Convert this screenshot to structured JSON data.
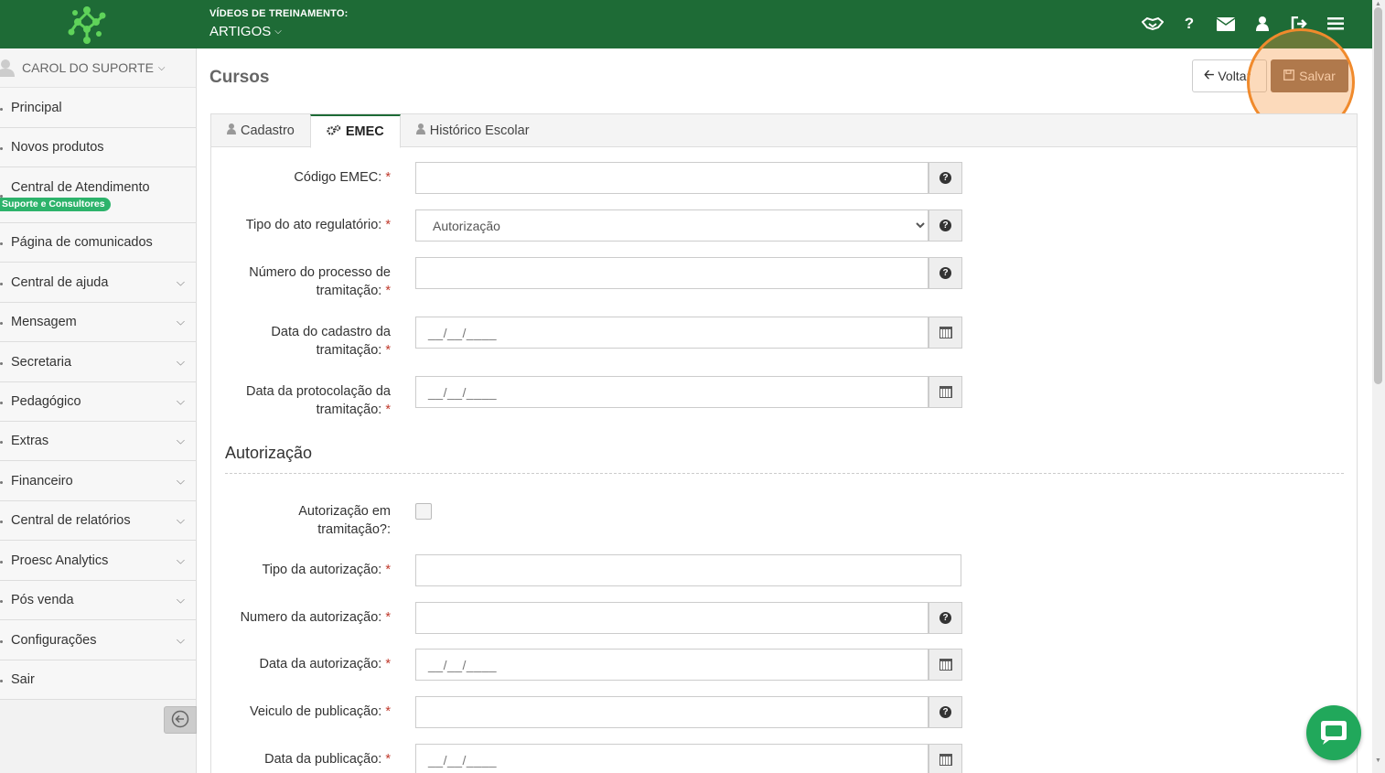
{
  "topbar": {
    "label": "VÍDEOS DE TREINAMENTO:",
    "menu": "ARTIGOS",
    "icons": [
      "handshake-icon",
      "question-icon",
      "envelope-icon",
      "user-icon",
      "sign-out-icon",
      "menu-icon"
    ]
  },
  "sidebar": {
    "user": "CAROL DO SUPORTE",
    "items": [
      {
        "label": "Principal"
      },
      {
        "label": "Novos produtos"
      },
      {
        "label": "Central de Atendimento",
        "badge": "Suporte e Consultores"
      },
      {
        "label": "Página de comunicados"
      },
      {
        "label": "Central de ajuda"
      },
      {
        "label": "Mensagem"
      },
      {
        "label": "Secretaria"
      },
      {
        "label": "Pedagógico"
      },
      {
        "label": "Extras"
      },
      {
        "label": "Financeiro"
      },
      {
        "label": "Central de relatórios"
      },
      {
        "label": "Proesc Analytics"
      },
      {
        "label": "Pós venda"
      },
      {
        "label": "Configurações"
      },
      {
        "label": "Sair"
      }
    ]
  },
  "main": {
    "title": "Cursos",
    "back_label": "Voltar",
    "save_label": "Salvar",
    "tabs": [
      {
        "label": "Cadastro"
      },
      {
        "label": "EMEC"
      },
      {
        "label": "Histórico Escolar"
      }
    ],
    "section_title": "Autorização",
    "date_placeholder": "__/__/____",
    "fields": {
      "codigo_emec": "Código EMEC:",
      "tipo_ato_l1": "Tipo do ato regulatório:",
      "tipo_ato_value": "Autorização",
      "numero_processo_l1": "Número do processo de",
      "numero_processo_l2": "tramitação:",
      "data_cadastro_l1": "Data do cadastro da",
      "data_cadastro_l2": "tramitação:",
      "data_protocolacao_l1": "Data da protocolação da",
      "data_protocolacao_l2": "tramitação:",
      "aut_tramitacao_l1": "Autorização em",
      "aut_tramitacao_l2": "tramitação?:",
      "tipo_autorizacao": "Tipo da autorização:",
      "numero_autorizacao": "Numero da autorização:",
      "data_autorizacao": "Data da autorização:",
      "veiculo_publicacao": "Veiculo de publicação:",
      "data_publicacao": "Data da publicação:"
    }
  },
  "colors": {
    "topbar": "#1e6b36",
    "save_button": "#8a6a55",
    "highlight": "#f08a2c",
    "chat": "#21a85b",
    "badge": "#2db36b"
  }
}
